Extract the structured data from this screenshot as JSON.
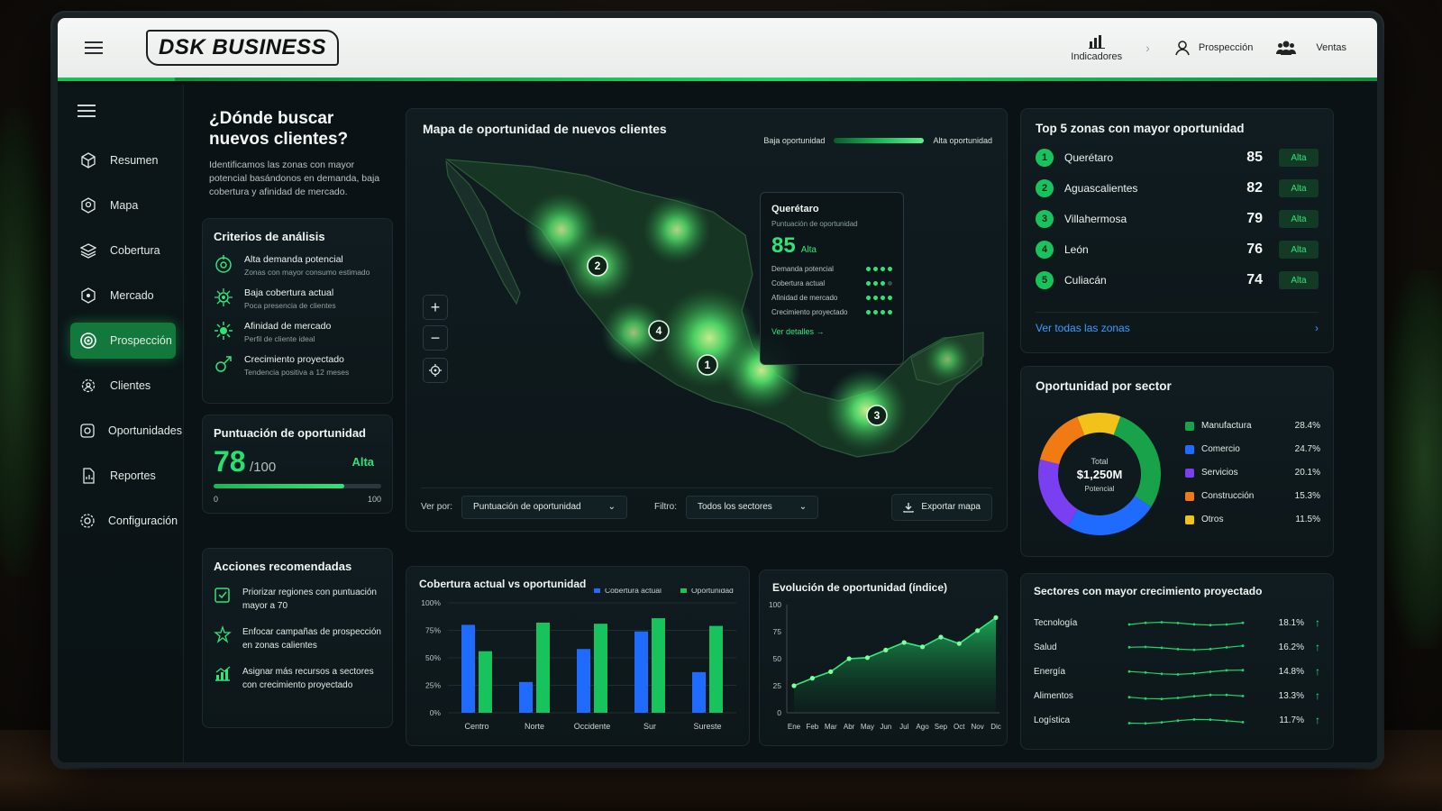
{
  "brand": "DSK BUSINESS",
  "top_nav": [
    {
      "label": "Indicadores",
      "icon": "bar-chart-icon"
    },
    {
      "label": "Prospección",
      "icon": "user-icon"
    },
    {
      "label": "Ventas",
      "icon": "users-icon"
    }
  ],
  "sidebar": {
    "items": [
      {
        "label": "Resumen",
        "icon": "cube-icon",
        "active": false
      },
      {
        "label": "Mapa",
        "icon": "map-pin-icon",
        "active": false
      },
      {
        "label": "Cobertura",
        "icon": "layers-icon",
        "active": false
      },
      {
        "label": "Mercado",
        "icon": "hexagon-icon",
        "active": false
      },
      {
        "label": "Prospección",
        "icon": "target-icon",
        "active": true
      },
      {
        "label": "Clientes",
        "icon": "gear-users-icon",
        "active": false
      },
      {
        "label": "Oportunidades",
        "icon": "document-icon",
        "active": false
      },
      {
        "label": "Reportes",
        "icon": "report-icon",
        "active": false
      },
      {
        "label": "Configuración",
        "icon": "settings-icon",
        "active": false
      }
    ]
  },
  "intro": {
    "title": "¿Dónde buscar nuevos clientes?",
    "text": "Identificamos las zonas con mayor potencial basándonos en demanda, baja cobertura y afinidad de mercado."
  },
  "criteria": {
    "title": "Criterios de análisis",
    "items": [
      {
        "title": "Alta demanda potencial",
        "sub": "Zonas con mayor consumo estimado"
      },
      {
        "title": "Baja cobertura actual",
        "sub": "Poca presencia de clientes"
      },
      {
        "title": "Afinidad de mercado",
        "sub": "Perfil de cliente ideal"
      },
      {
        "title": "Crecimiento proyectado",
        "sub": "Tendencia positiva a 12 meses"
      }
    ]
  },
  "score": {
    "title": "Puntuación de oportunidad",
    "value": "78",
    "denominator": "/100",
    "level": "Alta",
    "fraction": 0.78,
    "min": "0",
    "max": "100"
  },
  "actions": {
    "title": "Acciones recomendadas",
    "items": [
      "Priorizar regiones con puntuación mayor a 70",
      "Enfocar campañas de prospección en zonas calientes",
      "Asignar más recursos a sectores con crecimiento proyectado"
    ]
  },
  "map": {
    "title": "Mapa de oportunidad de nuevos clientes",
    "legend_low": "Baja oportunidad",
    "legend_high": "Alta oportunidad",
    "markers": [
      "1",
      "2",
      "3",
      "4"
    ],
    "tooltip": {
      "name": "Querétaro",
      "sub": "Puntuación de oportunidad",
      "score": "85",
      "level": "Alta",
      "rows": [
        {
          "label": "Demanda potencial",
          "filled": 4
        },
        {
          "label": "Cobertura actual",
          "filled": 3
        },
        {
          "label": "Afinidad de mercado",
          "filled": 4
        },
        {
          "label": "Crecimiento proyectado",
          "filled": 4
        }
      ],
      "link": "Ver detalles →"
    },
    "ver_por_label": "Ver por:",
    "ver_por_value": "Puntuación de oportunidad",
    "filtro_label": "Filtro:",
    "filtro_value": "Todos los sectores",
    "export_label": "Exportar mapa"
  },
  "top5": {
    "title": "Top 5 zonas con mayor oportunidad",
    "rows": [
      {
        "rank": "1",
        "name": "Querétaro",
        "score": "85",
        "tag": "Alta"
      },
      {
        "rank": "2",
        "name": "Aguascalientes",
        "score": "82",
        "tag": "Alta"
      },
      {
        "rank": "3",
        "name": "Villahermosa",
        "score": "79",
        "tag": "Alta"
      },
      {
        "rank": "4",
        "name": "León",
        "score": "76",
        "tag": "Alta"
      },
      {
        "rank": "5",
        "name": "Culiacán",
        "score": "74",
        "tag": "Alta"
      }
    ],
    "see_all": "Ver todas las zonas"
  },
  "sector": {
    "title": "Oportunidad por sector",
    "center_label": "Total",
    "center_value": "$1,250M",
    "center_sub": "Potencial"
  },
  "bars_panel": {
    "title": "Cobertura actual vs oportunidad"
  },
  "evol_panel": {
    "title": "Evolución de oportunidad (índice)"
  },
  "growth": {
    "title": "Sectores con mayor crecimiento proyectado",
    "rows": [
      {
        "name": "Tecnología",
        "pct": "18.1%"
      },
      {
        "name": "Salud",
        "pct": "16.2%"
      },
      {
        "name": "Energía",
        "pct": "14.8%"
      },
      {
        "name": "Alimentos",
        "pct": "13.3%"
      },
      {
        "name": "Logística",
        "pct": "11.7%"
      }
    ]
  },
  "colors": {
    "accent": "#1fd46a",
    "blue": "#1f6bff",
    "manufactura": "#18a34a",
    "comercio": "#1f6bff",
    "servicios": "#7b3ff2",
    "construccion": "#f07a14",
    "otros": "#f2c21b"
  },
  "chart_data": [
    {
      "type": "pie",
      "title": "Oportunidad por sector",
      "categories": [
        "Manufactura",
        "Comercio",
        "Servicios",
        "Construcción",
        "Otros"
      ],
      "values": [
        28.4,
        24.7,
        20.1,
        15.3,
        11.5
      ],
      "labels": [
        "28.4%",
        "24.7%",
        "20.1%",
        "15.3%",
        "11.5%"
      ]
    },
    {
      "type": "bar",
      "title": "Cobertura actual vs oportunidad",
      "categories": [
        "Centro",
        "Norte",
        "Occidente",
        "Sur",
        "Sureste"
      ],
      "series": [
        {
          "name": "Cobertura actual",
          "values": [
            80,
            28,
            58,
            74,
            37
          ]
        },
        {
          "name": "Oportunidad",
          "values": [
            56,
            82,
            81,
            86,
            79
          ]
        }
      ],
      "ylim": [
        0,
        100
      ],
      "yticks": [
        "0%",
        "25%",
        "50%",
        "75%",
        "100%"
      ]
    },
    {
      "type": "area",
      "title": "Evolución de oportunidad (índice)",
      "x": [
        "Ene",
        "Feb",
        "Mar",
        "Abr",
        "May",
        "Jun",
        "Jul",
        "Ago",
        "Sep",
        "Oct",
        "Nov",
        "Dic"
      ],
      "values": [
        25,
        32,
        38,
        50,
        51,
        58,
        65,
        61,
        70,
        64,
        76,
        88
      ],
      "ylim": [
        0,
        100
      ],
      "yticks": [
        "0",
        "25",
        "50",
        "75",
        "100"
      ]
    },
    {
      "type": "line",
      "title": "Sectores con mayor crecimiento proyectado",
      "categories": [
        "Tecnología",
        "Salud",
        "Energía",
        "Alimentos",
        "Logística"
      ],
      "values": [
        18.1,
        16.2,
        14.8,
        13.3,
        11.7
      ]
    }
  ]
}
